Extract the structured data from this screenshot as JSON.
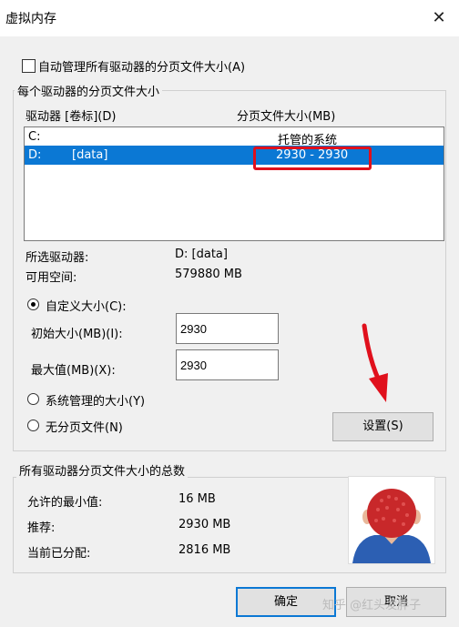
{
  "window": {
    "title": "虚拟内存"
  },
  "auto_manage": {
    "label": "自动管理所有驱动器的分页文件大小(A)",
    "checked": false
  },
  "per_drive_group": {
    "legend": "每个驱动器的分页文件大小",
    "col_drive": "驱动器 [卷标](D)",
    "col_size": "分页文件大小(MB)",
    "drives": [
      {
        "drive": "C:",
        "label": "",
        "size": "托管的系统",
        "selected": false
      },
      {
        "drive": "D:",
        "label": "[data]",
        "size": "2930 - 2930",
        "selected": true
      }
    ],
    "selected_drive_label": "所选驱动器:",
    "selected_drive_value": "D:  [data]",
    "free_space_label": "可用空间:",
    "free_space_value": "579880 MB",
    "custom_size": {
      "label": "自定义大小(C):",
      "selected": true
    },
    "initial_label": "初始大小(MB)(I):",
    "initial_value": "2930",
    "max_label": "最大值(MB)(X):",
    "max_value": "2930",
    "system_managed": {
      "label": "系统管理的大小(Y)",
      "selected": false
    },
    "no_paging": {
      "label": "无分页文件(N)",
      "selected": false
    },
    "set_button": "设置(S)"
  },
  "total_group": {
    "legend": "所有驱动器分页文件大小的总数",
    "min_label": "允许的最小值:",
    "min_value": "16 MB",
    "recommended_label": "推荐:",
    "recommended_value": "2930 MB",
    "allocated_label": "当前已分配:",
    "allocated_value": "2816 MB"
  },
  "buttons": {
    "ok": "确定",
    "cancel": "取消"
  },
  "watermark": "知乎 @红头发胖子",
  "colors": {
    "selection": "#0b78d4",
    "highlight_box": "#e0101c",
    "annotation_arrow": "#e0101c"
  }
}
